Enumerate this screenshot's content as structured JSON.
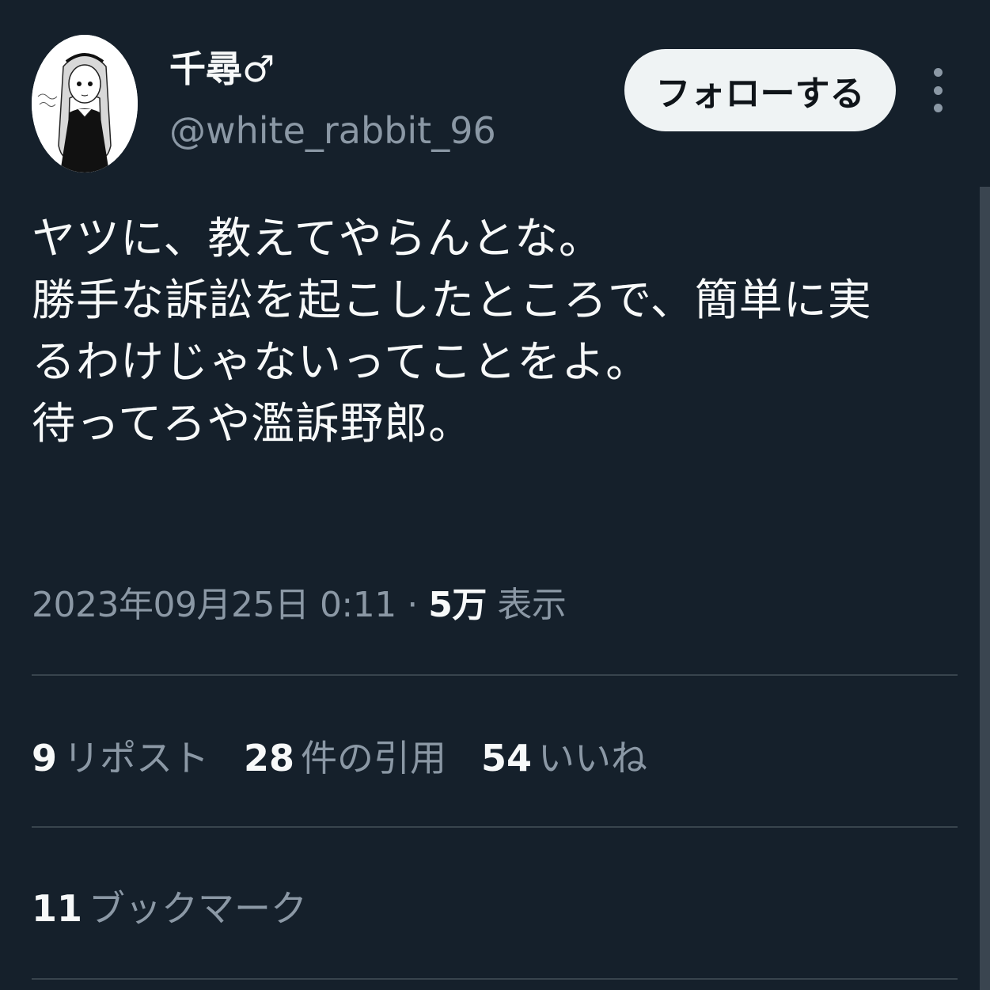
{
  "user": {
    "display_name": "千尋♂",
    "handle": "@white_rabbit_96"
  },
  "follow_button": {
    "label": "フォローする"
  },
  "tweet": {
    "lines": [
      "ヤツに、教えてやらんとな。",
      "勝手な訴訟を起こしたところで、簡単に実",
      "るわけじゃないってことをよ。",
      "待ってろや濫訴野郎。"
    ]
  },
  "meta": {
    "datetime": "2023年09月25日 0:11",
    "separator": "·",
    "views_count": "5万",
    "views_label": "表示"
  },
  "stats": {
    "reposts": {
      "count": "9",
      "label": "リポスト"
    },
    "quotes": {
      "count": "28",
      "label": "件の引用"
    },
    "likes": {
      "count": "54",
      "label": "いいね"
    }
  },
  "bookmarks": {
    "count": "11",
    "label": "ブックマーク"
  },
  "colors": {
    "background": "#15202b",
    "text": "#f7f9f9",
    "secondary_text": "#8b98a5",
    "divider": "#38444d",
    "button_bg": "#eff3f4"
  },
  "icons": [
    "more-vertical-icon",
    "avatar"
  ]
}
